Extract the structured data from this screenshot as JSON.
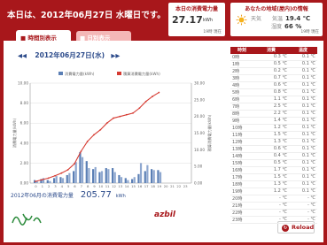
{
  "header": {
    "title": "本日は、2012年06月27日 水曜日です。"
  },
  "today_panel": {
    "label": "本日の消費電力量",
    "value": "27.17",
    "unit": "kWh",
    "time": "19時 現在"
  },
  "room_panel": {
    "label": "あなたの地域(屋内)の情報",
    "weather_label": "天気",
    "temp_label": "気温",
    "temp_value": "19.4 ℃",
    "humidity_label": "湿度",
    "humidity_value": "66 %",
    "time": "19時 現在",
    "weather_icon": "sun-icon"
  },
  "tabs": {
    "hourly": "時間別表示",
    "daily": "日別表示"
  },
  "date_nav": {
    "prev_symbol": "◀◀",
    "date": "2012年06月27日(水)",
    "next_symbol": "▶▶"
  },
  "chart_data": {
    "type": "bar",
    "title": "",
    "xlabel": "時間",
    "ylabel": "消費電力量(kWh)",
    "ylabel_right": "積算消費電力量(kWh)",
    "ylim": [
      0,
      10
    ],
    "ylim_right": [
      0,
      30
    ],
    "legend": [
      "消費電力量(kWh)",
      "積算消費電力量(kWh)"
    ],
    "categories": [
      "0",
      "1",
      "2",
      "3",
      "4",
      "5",
      "6",
      "7",
      "8",
      "9",
      "10",
      "11",
      "12",
      "13",
      "14",
      "15",
      "16",
      "17",
      "18",
      "19",
      "20",
      "21",
      "22",
      "23"
    ],
    "series": [
      {
        "name": "消費電力量(kWh)",
        "type": "bar",
        "color": "#5b7fb5",
        "values": [
          0.3,
          0.4,
          0.3,
          0.5,
          0.6,
          0.8,
          1.2,
          3.1,
          2.2,
          1.4,
          1.1,
          1.5,
          1.5,
          0.8,
          0.5,
          0.4,
          0.9,
          1.2,
          1.4,
          1.3,
          0,
          0,
          0,
          0
        ],
        "values_b": [
          0.2,
          0.5,
          0.2,
          0.7,
          0.5,
          1.0,
          2.1,
          2.6,
          1.5,
          1.6,
          1.2,
          1.4,
          1.1,
          0.6,
          0.3,
          0.6,
          2.0,
          1.8,
          1.3,
          1.1,
          0,
          0,
          0,
          0
        ]
      },
      {
        "name": "積算消費電力量(kWh)",
        "type": "line",
        "color": "#d63b32",
        "values": [
          0.5,
          1.0,
          1.5,
          2.2,
          3.0,
          4.0,
          5.8,
          9.5,
          12.5,
          14.5,
          16.0,
          18.0,
          19.5,
          20.0,
          20.5,
          21.0,
          22.5,
          24.5,
          26.0,
          27.2
        ]
      }
    ],
    "yticks": [
      "0.00",
      "2.00",
      "4.00",
      "6.00",
      "8.00",
      "10.00"
    ],
    "yticks_right": [
      "0.00",
      "5.00",
      "10.00",
      "15.00",
      "20.00",
      "25.00",
      "30.00"
    ],
    "grid": true
  },
  "total": {
    "label": "2012年06月の消費電力量",
    "value": "205.77",
    "unit": "kWh"
  },
  "footer": {
    "logo": "azbil",
    "reload": "Reload"
  },
  "table": {
    "headers": [
      "時刻",
      "消費",
      "温度"
    ],
    "rows": [
      [
        "0時",
        "0.3 ℃",
        "0.1 ℃"
      ],
      [
        "1時",
        "0.5 ℃",
        "0.1 ℃"
      ],
      [
        "2時",
        "0.2 ℃",
        "0.1 ℃"
      ],
      [
        "3時",
        "0.7 ℃",
        "0.1 ℃"
      ],
      [
        "4時",
        "0.6 ℃",
        "0.1 ℃"
      ],
      [
        "5時",
        "0.8 ℃",
        "0.1 ℃"
      ],
      [
        "6時",
        "1.1 ℃",
        "0.1 ℃"
      ],
      [
        "7時",
        "2.5 ℃",
        "0.1 ℃"
      ],
      [
        "8時",
        "2.2 ℃",
        "0.1 ℃"
      ],
      [
        "9時",
        "1.4 ℃",
        "0.1 ℃"
      ],
      [
        "10時",
        "1.2 ℃",
        "0.1 ℃"
      ],
      [
        "11時",
        "1.5 ℃",
        "0.1 ℃"
      ],
      [
        "12時",
        "1.3 ℃",
        "0.1 ℃"
      ],
      [
        "13時",
        "0.6 ℃",
        "0.1 ℃"
      ],
      [
        "14時",
        "0.4 ℃",
        "0.1 ℃"
      ],
      [
        "15時",
        "0.5 ℃",
        "0.1 ℃"
      ],
      [
        "16時",
        "1.7 ℃",
        "0.1 ℃"
      ],
      [
        "17時",
        "1.5 ℃",
        "0.1 ℃"
      ],
      [
        "18時",
        "1.3 ℃",
        "0.1 ℃"
      ],
      [
        "19時",
        "1.2 ℃",
        "0.1 ℃"
      ],
      [
        "20時",
        "- ℃",
        "- ℃"
      ],
      [
        "21時",
        "- ℃",
        "- ℃"
      ],
      [
        "22時",
        "- ℃",
        "- ℃"
      ],
      [
        "23時",
        "- ℃",
        "- ℃"
      ]
    ]
  }
}
